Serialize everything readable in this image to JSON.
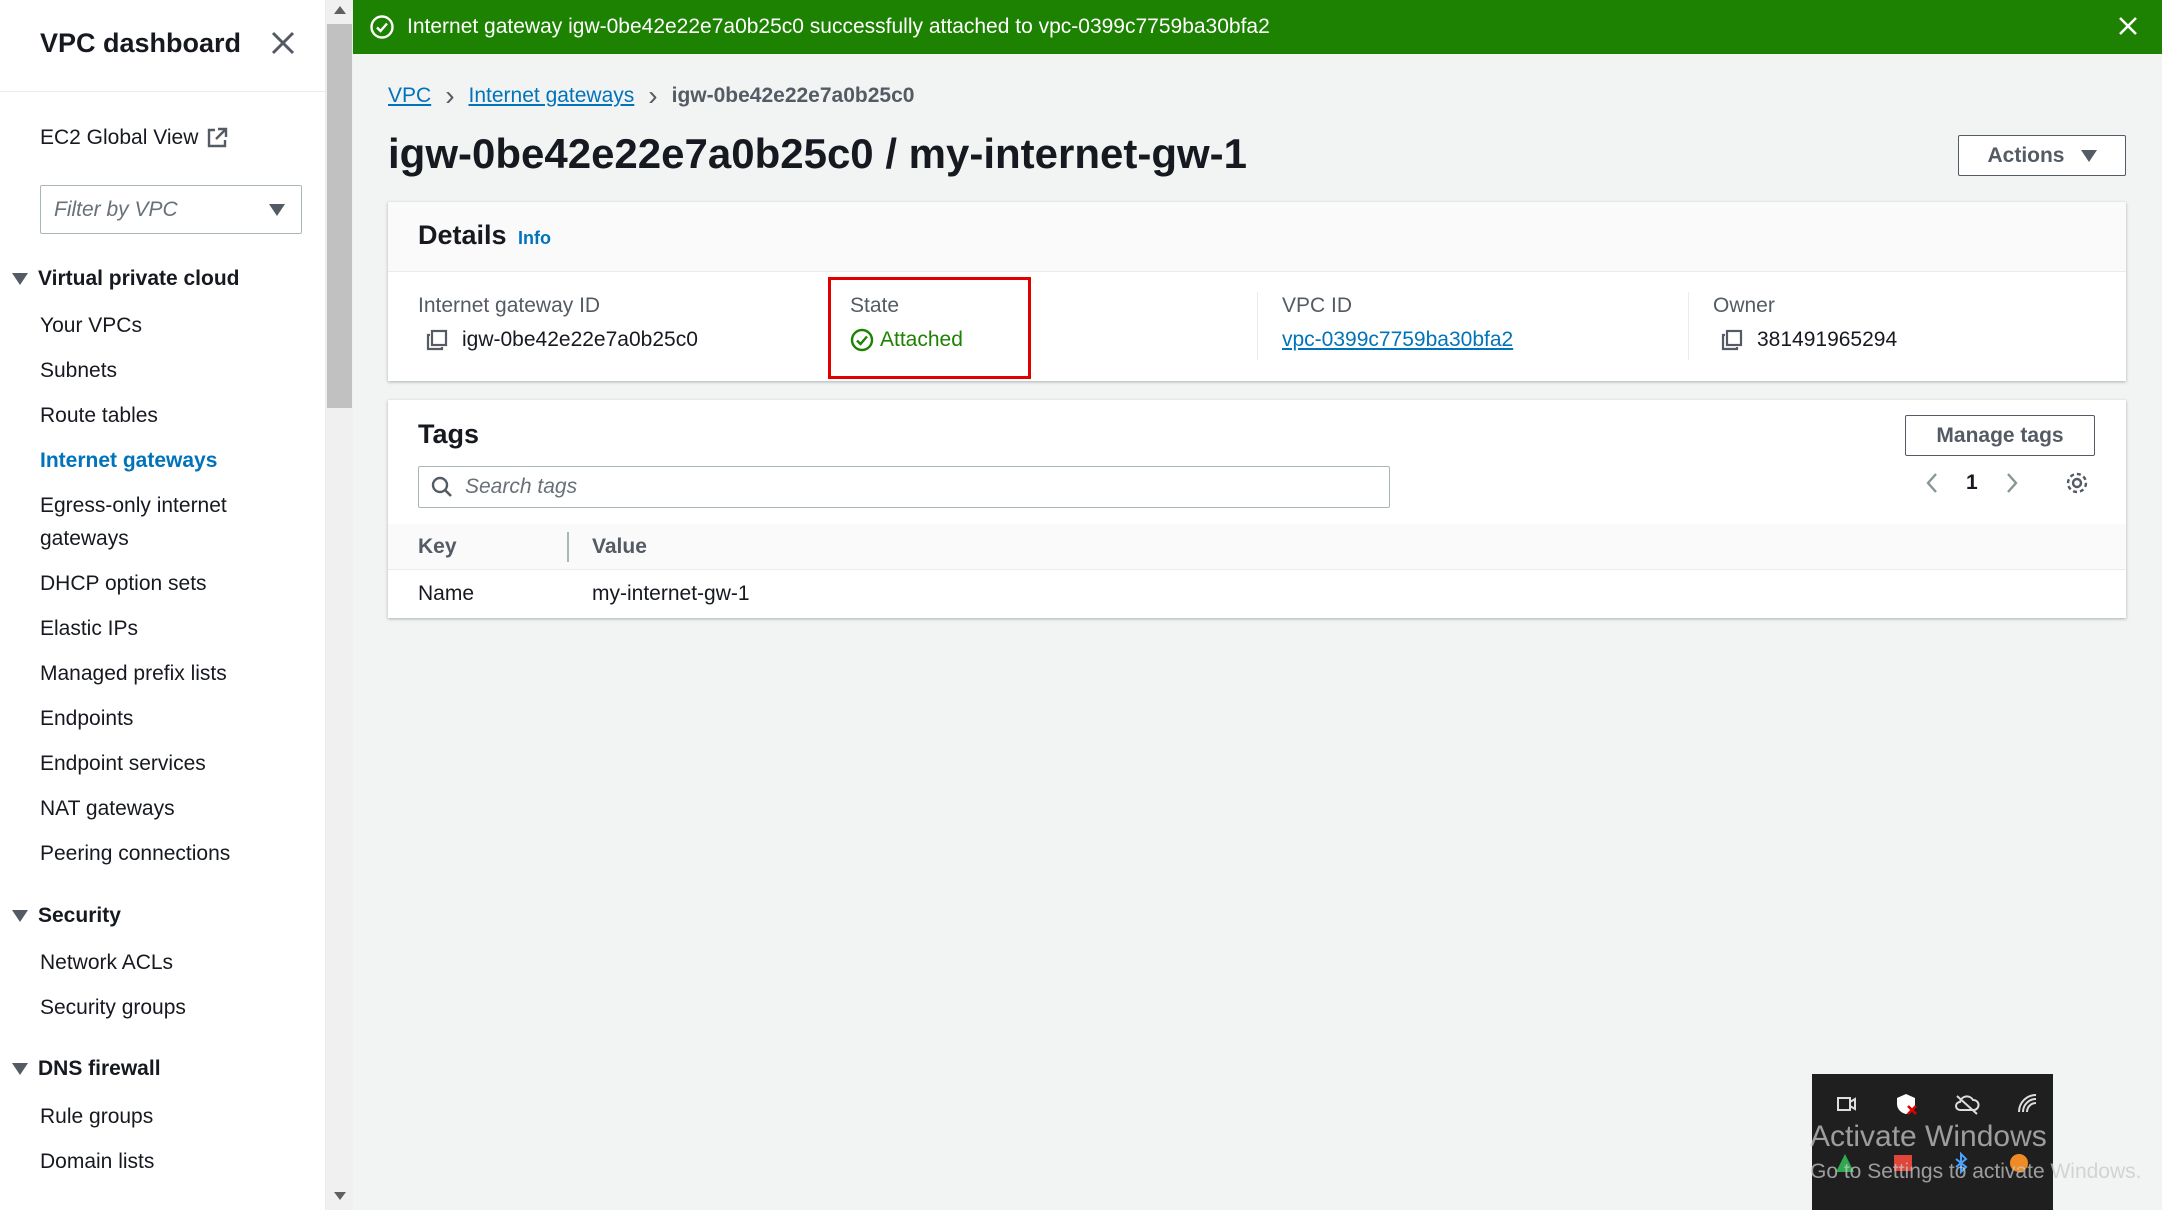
{
  "sidebar": {
    "title": "VPC dashboard",
    "global_view": "EC2 Global View",
    "filter_placeholder": "Filter by VPC",
    "sections": [
      {
        "label": "Virtual private cloud"
      },
      {
        "label": "Security"
      },
      {
        "label": "DNS firewall"
      }
    ],
    "items": [
      "Your VPCs",
      "Subnets",
      "Route tables",
      "Internet gateways",
      "Egress-only internet",
      "gateways",
      "DHCP option sets",
      "Elastic IPs",
      "Managed prefix lists",
      "Endpoints",
      "Endpoint services",
      "NAT gateways",
      "Peering connections",
      "Network ACLs",
      "Security groups",
      "Rule groups",
      "Domain lists"
    ],
    "active_item": "Internet gateways"
  },
  "flash": {
    "message": "Internet gateway igw-0be42e22e7a0b25c0 successfully attached to vpc-0399c7759ba30bfa2",
    "color": "#1d8102"
  },
  "breadcrumb": {
    "items": [
      "VPC",
      "Internet gateways"
    ],
    "current": "igw-0be42e22e7a0b25c0"
  },
  "page": {
    "title": "igw-0be42e22e7a0b25c0 / my-internet-gw-1",
    "actions_label": "Actions"
  },
  "details": {
    "title": "Details",
    "info_link": "Info",
    "fields": {
      "gateway_id_label": "Internet gateway ID",
      "gateway_id": "igw-0be42e22e7a0b25c0",
      "state_label": "State",
      "state": "Attached",
      "vpc_id_label": "VPC ID",
      "vpc_id": "vpc-0399c7759ba30bfa2",
      "owner_label": "Owner",
      "owner": "381491965294"
    }
  },
  "tags": {
    "title": "Tags",
    "manage_label": "Manage tags",
    "search_placeholder": "Search tags",
    "page": "1",
    "columns": {
      "key": "Key",
      "value": "Value"
    },
    "rows": [
      {
        "key": "Name",
        "value": "my-internet-gw-1"
      }
    ]
  },
  "watermark": {
    "line1": "Activate Windows",
    "line2": "Go to Settings to activate Windows."
  },
  "colors": {
    "link": "#0073bb",
    "success": "#1d8102",
    "highlight": "#e00000"
  }
}
